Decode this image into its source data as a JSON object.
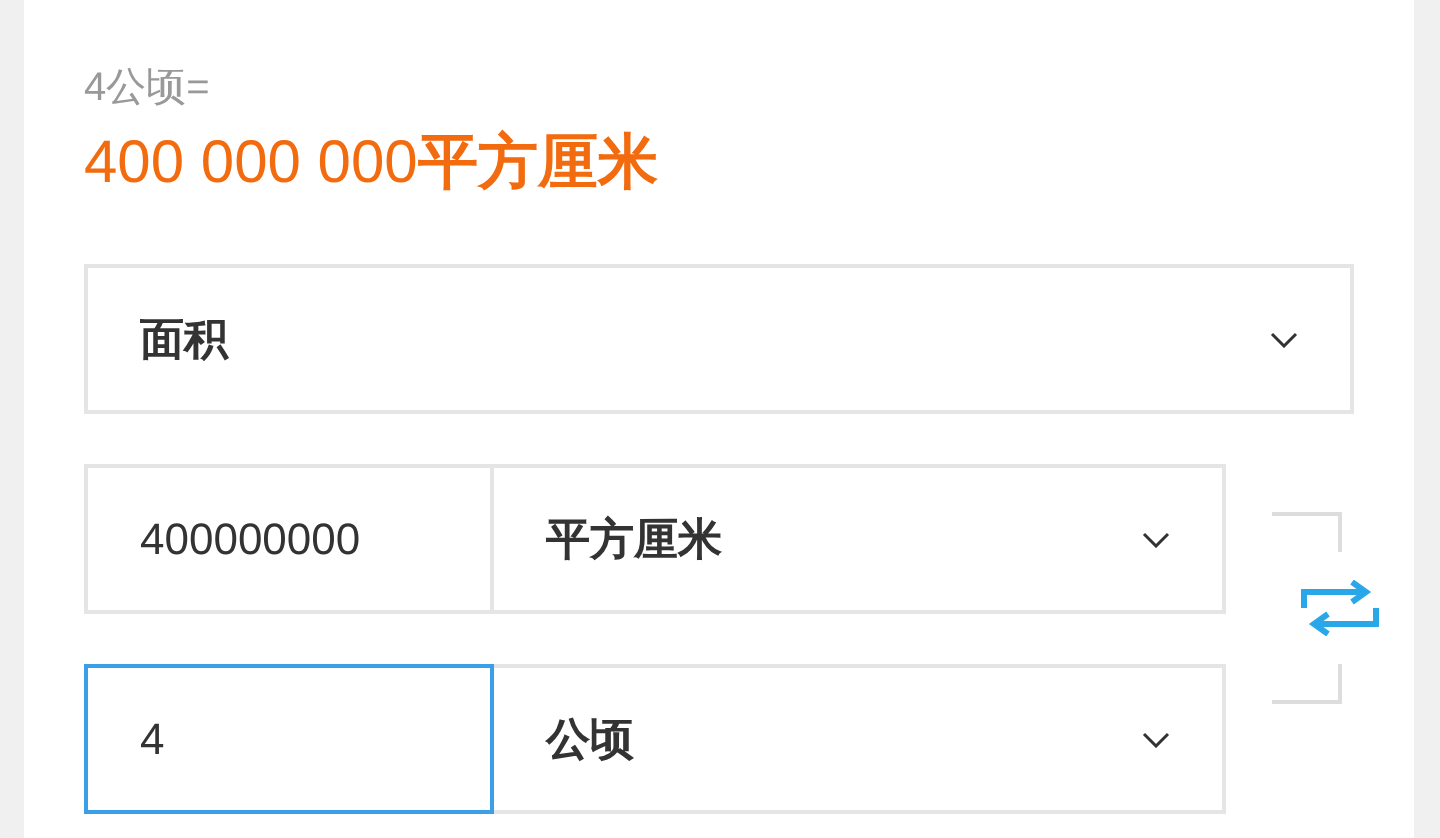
{
  "result": {
    "expression": "4公顷=",
    "answer": "400 000 000**平方厘米**"
  },
  "category": {
    "value": "面积"
  },
  "rows": [
    {
      "value": "400000000",
      "unit": "平方厘米",
      "focused": false
    },
    {
      "value": "4",
      "unit": "公顷",
      "focused": true
    }
  ]
}
